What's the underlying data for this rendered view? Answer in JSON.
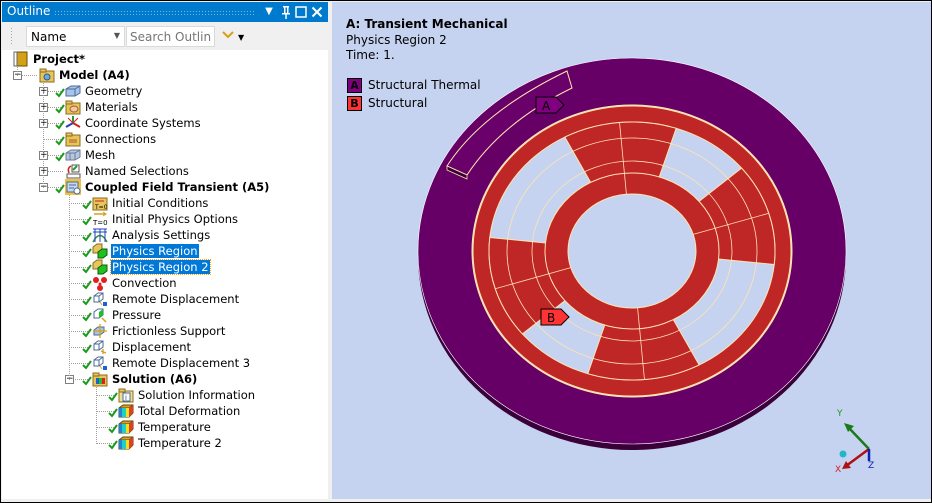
{
  "outline": {
    "title": "Outline",
    "controls": {
      "dropdown": "▾",
      "pin": "📌",
      "maximize": "□",
      "close": "✕"
    },
    "filter_select": {
      "value": "Name"
    },
    "search": {
      "placeholder": "Search Outline"
    },
    "tree": [
      {
        "label": "Project*",
        "level": 0,
        "bold": true,
        "icon": "project-icon",
        "expander": "none",
        "check": false
      },
      {
        "label": "Model (A4)",
        "level": 1,
        "bold": true,
        "icon": "model-icon",
        "expander": "minus",
        "check": false
      },
      {
        "label": "Geometry",
        "level": 2,
        "icon": "geometry-icon",
        "expander": "plus",
        "check": true
      },
      {
        "label": "Materials",
        "level": 2,
        "icon": "materials-icon",
        "expander": "plus",
        "check": true
      },
      {
        "label": "Coordinate Systems",
        "level": 2,
        "icon": "coordinate-systems-icon",
        "expander": "plus",
        "check": true
      },
      {
        "label": "Connections",
        "level": 2,
        "icon": "connections-icon",
        "expander": "none",
        "check": true
      },
      {
        "label": "Mesh",
        "level": 2,
        "icon": "mesh-icon",
        "expander": "plus",
        "check": true
      },
      {
        "label": "Named Selections",
        "level": 2,
        "icon": "named-selections-icon",
        "expander": "plus",
        "check": false
      },
      {
        "label": "Coupled Field Transient (A5)",
        "level": 2,
        "bold": true,
        "icon": "analysis-icon",
        "expander": "minus",
        "check": true
      },
      {
        "label": "Initial Conditions",
        "level": 3,
        "icon": "initial-conditions-icon",
        "expander": "none",
        "check": true
      },
      {
        "label": "Initial Physics Options",
        "level": 3,
        "icon": "initial-physics-icon",
        "expander": "none",
        "check": true
      },
      {
        "label": "Analysis Settings",
        "level": 3,
        "icon": "analysis-settings-icon",
        "expander": "none",
        "check": true
      },
      {
        "label": "Physics Region",
        "level": 3,
        "icon": "physics-region-icon",
        "expander": "none",
        "check": true,
        "state": "selected"
      },
      {
        "label": "Physics Region 2",
        "level": 3,
        "icon": "physics-region-icon",
        "expander": "none",
        "check": true,
        "state": "focused"
      },
      {
        "label": "Convection",
        "level": 3,
        "icon": "convection-icon",
        "expander": "none",
        "check": true
      },
      {
        "label": "Remote Displacement",
        "level": 3,
        "icon": "remote-displacement-icon",
        "expander": "none",
        "check": true
      },
      {
        "label": "Pressure",
        "level": 3,
        "icon": "pressure-icon",
        "expander": "none",
        "check": true
      },
      {
        "label": "Frictionless Support",
        "level": 3,
        "icon": "frictionless-support-icon",
        "expander": "none",
        "check": true
      },
      {
        "label": "Displacement",
        "level": 3,
        "icon": "displacement-icon",
        "expander": "none",
        "check": true
      },
      {
        "label": "Remote Displacement 3",
        "level": 3,
        "icon": "remote-displacement-icon",
        "expander": "none",
        "check": true
      },
      {
        "label": "Solution (A6)",
        "level": 3,
        "bold": true,
        "icon": "solution-icon",
        "expander": "minus",
        "check": true
      },
      {
        "label": "Solution Information",
        "level": 4,
        "icon": "solution-information-icon",
        "expander": "none",
        "check": true
      },
      {
        "label": "Total Deformation",
        "level": 4,
        "icon": "result-icon",
        "expander": "none",
        "check": true
      },
      {
        "label": "Temperature",
        "level": 4,
        "icon": "result-icon",
        "expander": "none",
        "check": true
      },
      {
        "label": "Temperature 2",
        "level": 4,
        "icon": "result-icon",
        "expander": "none",
        "check": true
      }
    ]
  },
  "viewport": {
    "title": "A: Transient Mechanical",
    "subtitle": "Physics Region 2",
    "time": "Time: 1.",
    "legend": [
      {
        "key": "A",
        "label": "Structural Thermal",
        "color": "#800080"
      },
      {
        "key": "B",
        "label": "Structural",
        "color": "#ff3333"
      }
    ],
    "callouts": [
      {
        "key": "A",
        "color": "#800080"
      },
      {
        "key": "B",
        "color": "#ff3333"
      }
    ],
    "colors": {
      "background": "#c5d3f0",
      "outer_ring": "#660066",
      "inner_part": "#bf2626",
      "edge": "#ffe4b0"
    },
    "triad": {
      "x": "X",
      "y": "Y",
      "z": "Z"
    }
  }
}
